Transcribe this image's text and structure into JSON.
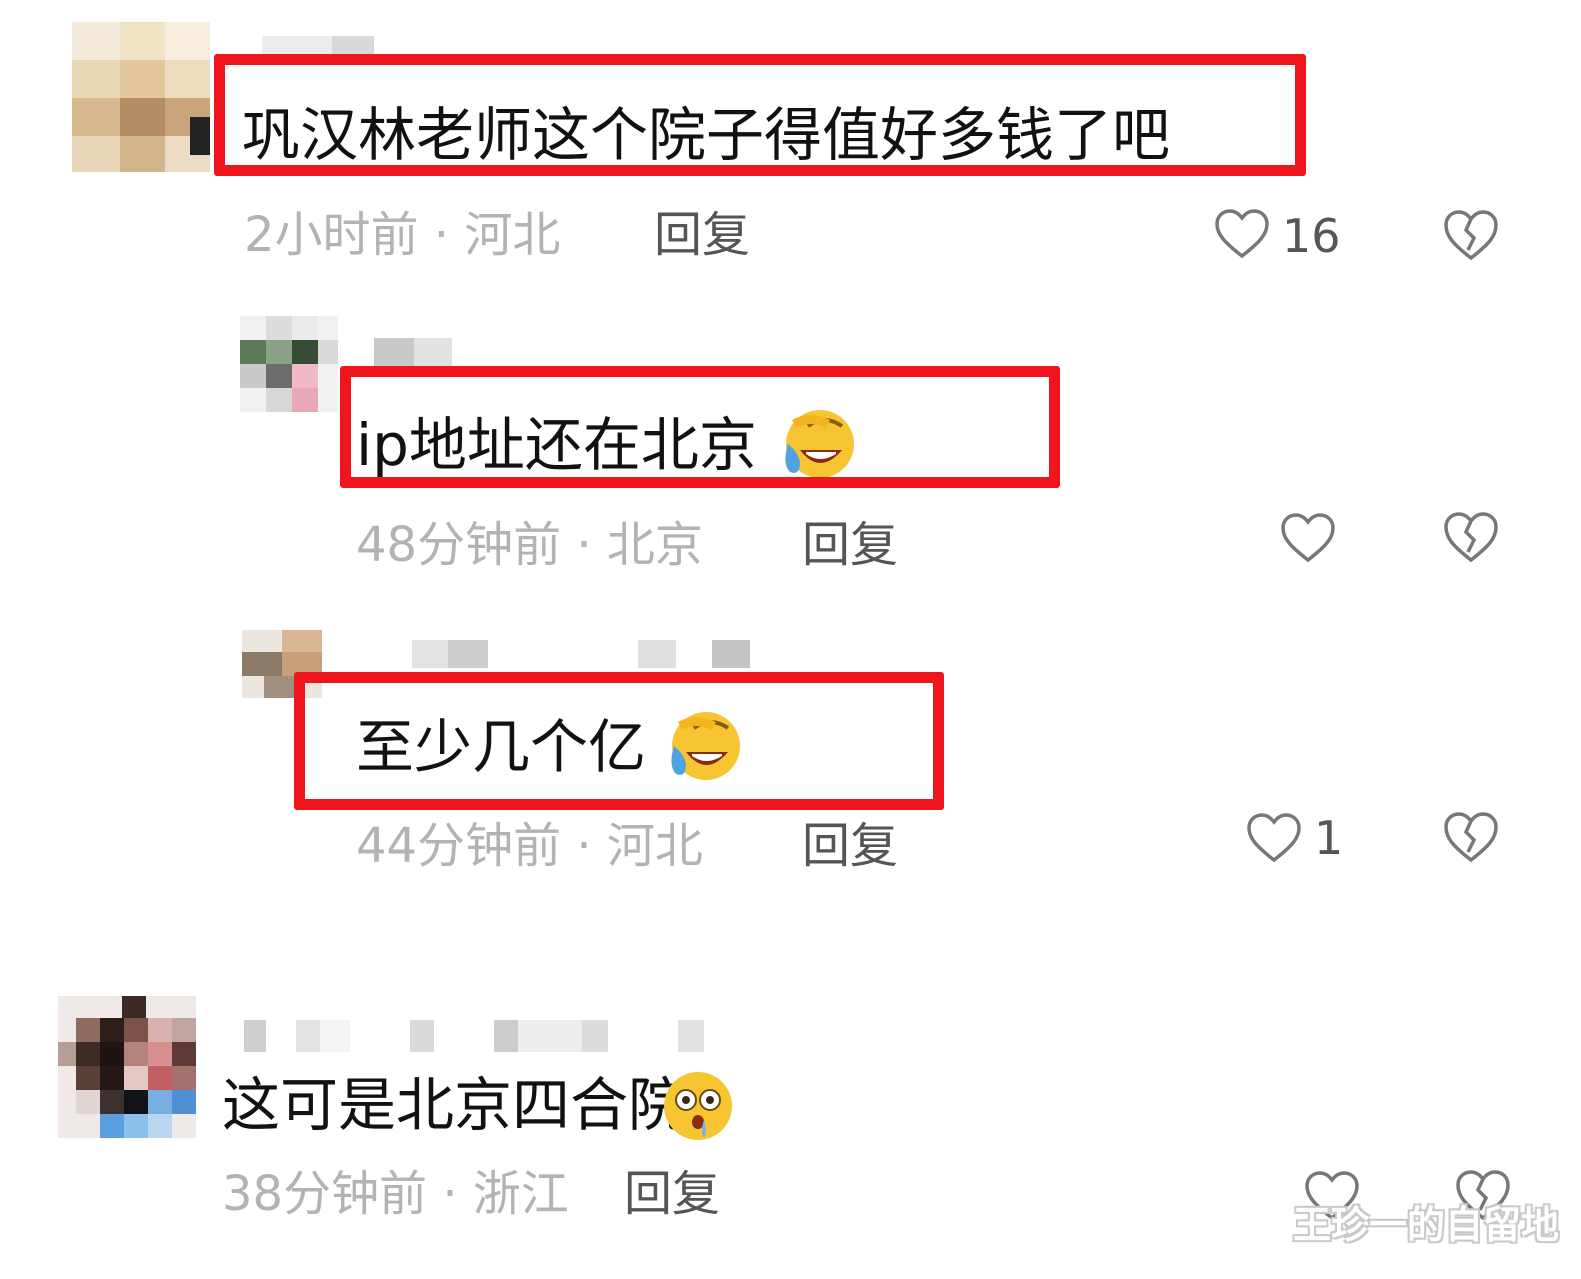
{
  "comments": [
    {
      "text": "巩汉林老师这个院子得值好多钱了吧",
      "time_location": "2小时前 · 河北",
      "reply_label": "回复",
      "like_count": "16",
      "icons": [
        "heart-outline-icon",
        "broken-heart-icon"
      ]
    },
    {
      "text": "ip地址还在北京",
      "emoji": "laughing-tears-emoji",
      "time_location": "48分钟前 · 北京",
      "reply_label": "回复",
      "like_count": "",
      "icons": [
        "heart-outline-icon",
        "broken-heart-icon"
      ]
    },
    {
      "text": "至少几个亿",
      "emoji": "laughing-tears-emoji",
      "time_location": "44分钟前 · 河北",
      "reply_label": "回复",
      "like_count": "1",
      "icons": [
        "heart-outline-icon",
        "broken-heart-icon"
      ]
    },
    {
      "text": "这可是北京四合院",
      "emoji": "shocked-drooling-emoji",
      "time_location": "38分钟前 · 浙江",
      "reply_label": "回复",
      "like_count": "",
      "icons": [
        "heart-outline-icon",
        "broken-heart-icon"
      ]
    }
  ],
  "watermark": "王珍一的自留地",
  "colors": {
    "highlight_box": "#f0141c",
    "meta_text": "#b3b3b3",
    "reply_text": "#555555"
  }
}
